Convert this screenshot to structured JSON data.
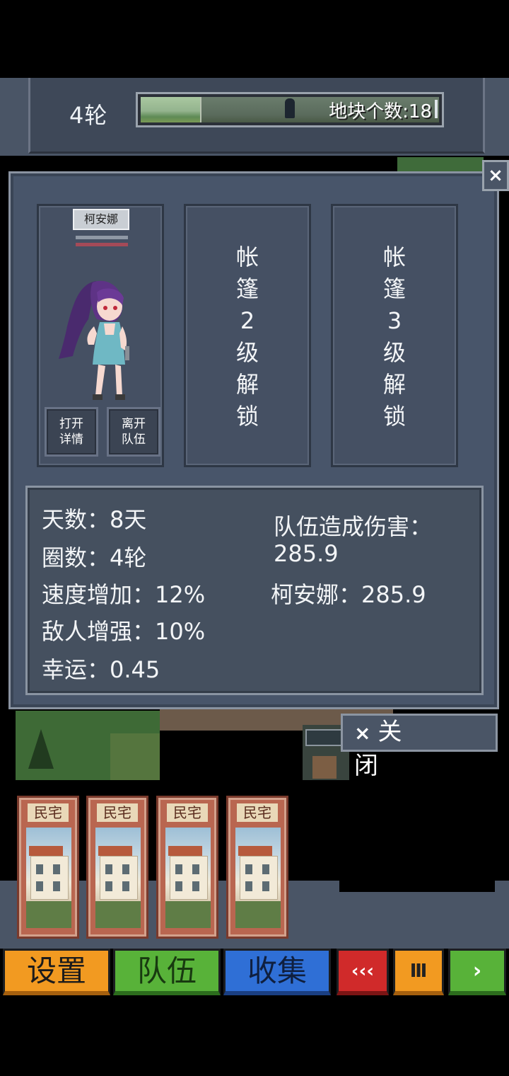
{
  "header": {
    "round_label": "4轮",
    "tile_count_text": "地块个数:18",
    "loop_progress": 0.2
  },
  "dialog": {
    "close_icon": "×",
    "character": {
      "name": "柯安娜",
      "open_details": "打开\n详情",
      "leave_team": "离开\n队伍"
    },
    "slots": [
      {
        "text": "帐\n篷\n2\n级\n解\n锁"
      },
      {
        "text": "帐\n篷\n3\n级\n解\n锁"
      }
    ],
    "stats": {
      "days": "天数：8天",
      "rounds": "圈数：4轮",
      "speed_bonus": "速度增加：12%",
      "enemy_boost": "敌人增强：10%",
      "luck": "幸运：0.45",
      "team_damage_label": "队伍造成伤害：",
      "team_damage_value": "285.9",
      "member_damage": "柯安娜：285.9"
    },
    "close_button": {
      "icon": "×",
      "label": "关闭"
    }
  },
  "hand": {
    "cards": [
      {
        "title": "民宅"
      },
      {
        "title": "民宅"
      },
      {
        "title": "民宅"
      },
      {
        "title": "民宅"
      }
    ]
  },
  "toolbar": {
    "settings": "设置",
    "team": "队伍",
    "collect": "收集",
    "rewind": "‹‹‹",
    "pause": "Ⅲ",
    "next": "›"
  },
  "colors": {
    "panel": "#48556a",
    "settings": "#f29a21",
    "team": "#58b239",
    "collect": "#2f6fd6",
    "rewind": "#d02a2a"
  }
}
